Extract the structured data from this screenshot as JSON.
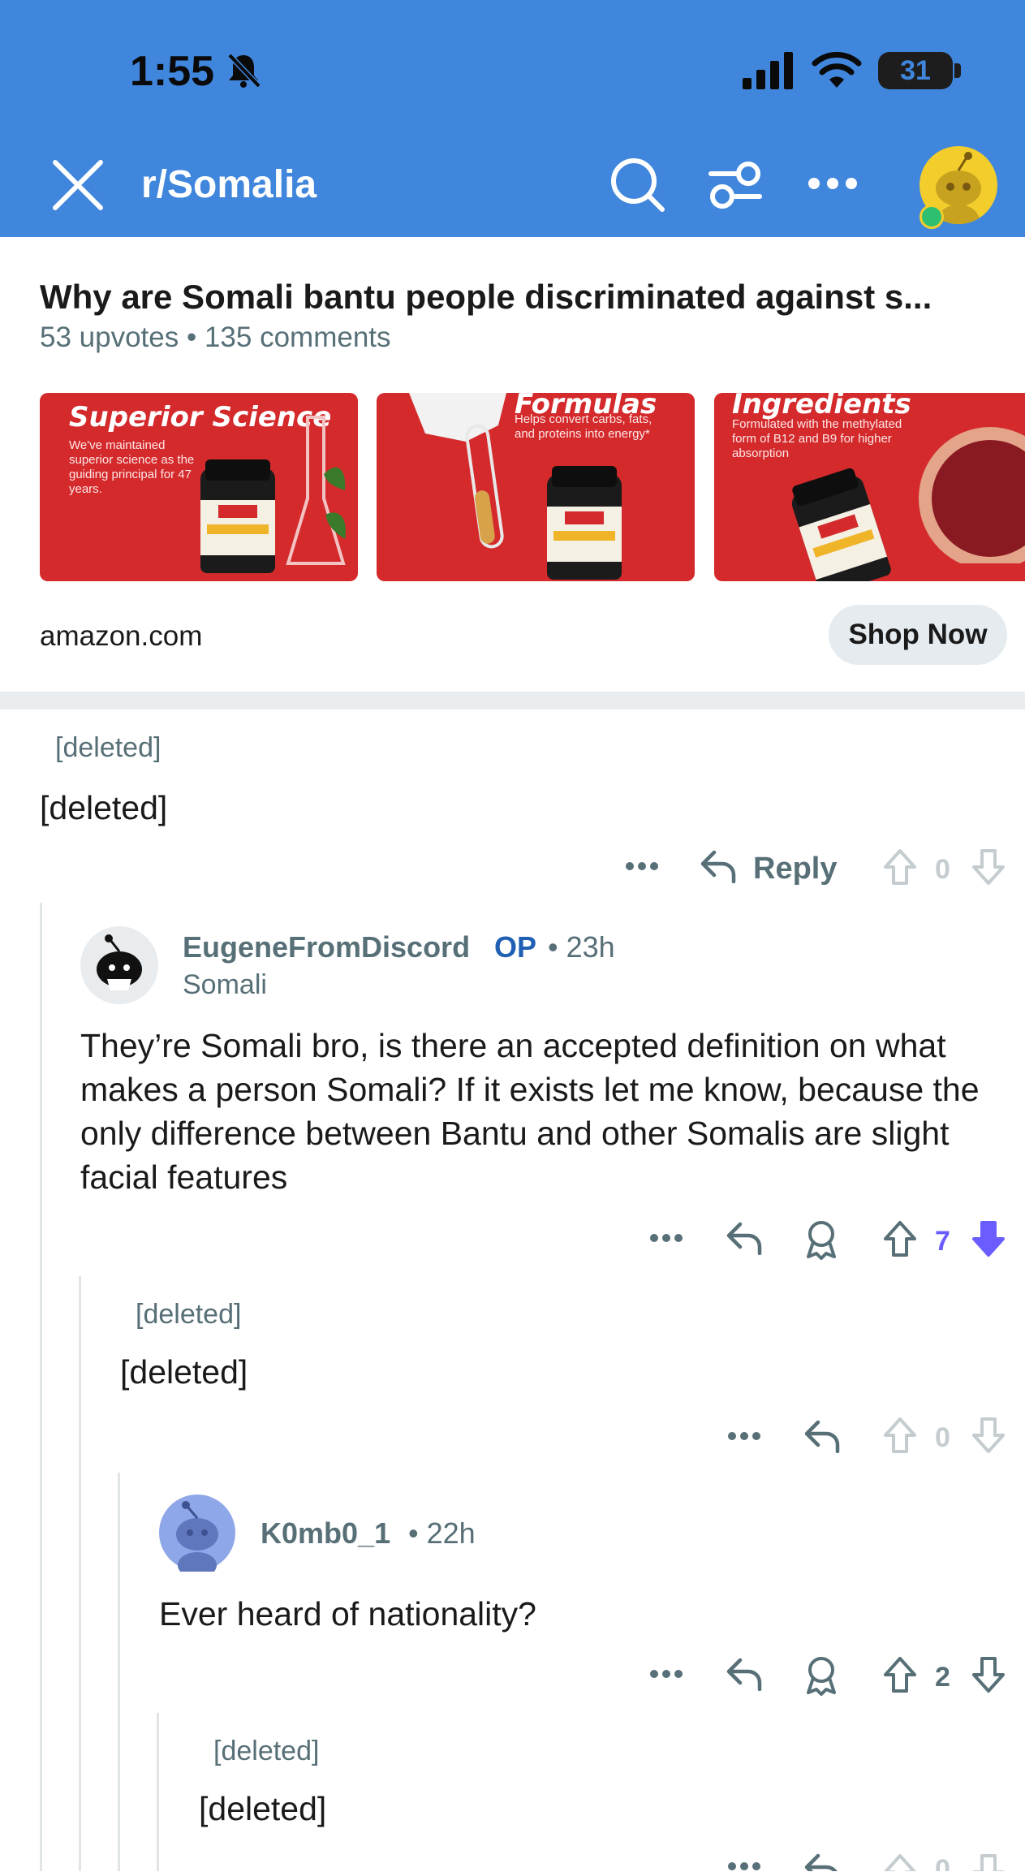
{
  "status_bar": {
    "time": "1:55",
    "battery": "31"
  },
  "header": {
    "subreddit": "r/Somalia"
  },
  "post": {
    "title": "Why are Somali bantu people discriminated against s...",
    "upvotes": "53 upvotes",
    "comments": "135 comments"
  },
  "ad": {
    "cards": [
      {
        "headline": "Superior Science",
        "text": "We've maintained superior science as the guiding principal for 47 years."
      },
      {
        "headline": "Formulas",
        "text": "Helps convert carbs, fats, and proteins into energy*"
      },
      {
        "headline": "Ingredients",
        "text": "Formulated with the methylated form of B12 and B9 for higher absorption"
      }
    ],
    "domain": "amazon.com",
    "cta": "Shop Now"
  },
  "comments": [
    {
      "author": "[deleted]",
      "body": "[deleted]",
      "reply_label": "Reply",
      "score": "0"
    },
    {
      "author": "EugeneFromDiscord",
      "op": "OP",
      "time": "23h",
      "flair": "Somali",
      "body": "They’re Somali bro, is there an accepted definition on what makes a person Somali? If it exists let me know, because the only difference between Bantu and other Somalis are slight facial features",
      "score": "7"
    },
    {
      "author": "[deleted]",
      "body": "[deleted]",
      "score": "0"
    },
    {
      "author": "K0mb0_1",
      "time": "22h",
      "body": "Ever heard of nationality?",
      "score": "2"
    },
    {
      "author": "[deleted]",
      "body": "[deleted]",
      "score": "0"
    }
  ],
  "colors": {
    "header_bg": "#3f86dc",
    "op": "#1f5fb4",
    "downvoted": "#6a5cff",
    "ad_red": "#d42a2c"
  },
  "icons": [
    "close-icon",
    "search-icon",
    "filter-icon",
    "more-icon",
    "avatar",
    "reply-icon",
    "award-icon",
    "upvote-icon",
    "downvote-icon"
  ]
}
